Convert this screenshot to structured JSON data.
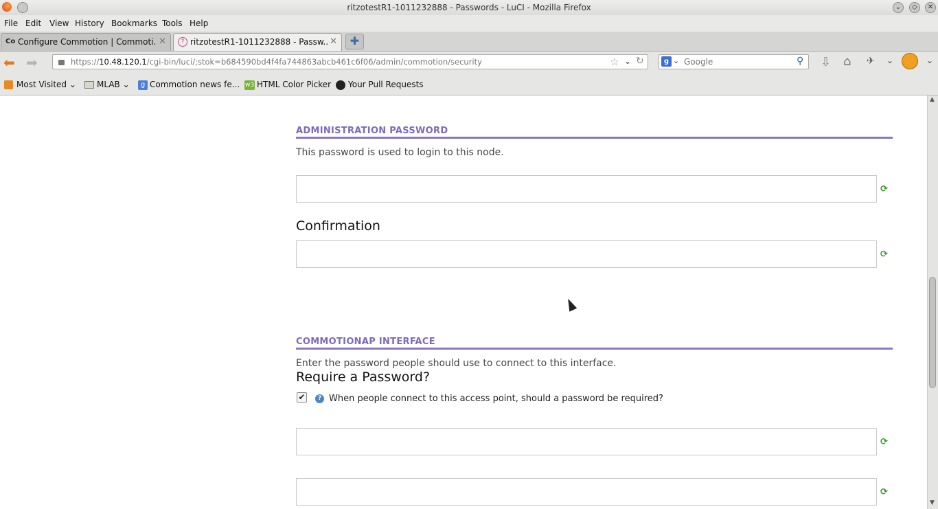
{
  "window": {
    "title": "ritzotestR1-1011232888 - Passwords - LuCI - Mozilla Firefox"
  },
  "menu": [
    "File",
    "Edit",
    "View",
    "History",
    "Bookmarks",
    "Tools",
    "Help"
  ],
  "tabs": [
    {
      "label": "Configure Commotion | Commoti...",
      "favicon": "Co"
    },
    {
      "label": "ritzotestR1-1011232888 - Passw...",
      "favicon": "?"
    }
  ],
  "url": {
    "scheme": "https://",
    "host": "10.48.120.1",
    "path": "/cgi-bin/luci/;stok=b684590bd4f4fa744863abcb461c6f06/admin/commotion/security"
  },
  "search": {
    "placeholder": "Google"
  },
  "bookmarks": [
    "Most Visited",
    "MLAB",
    "Commotion news fe...",
    "HTML Color Picker",
    "Your Pull Requests"
  ],
  "admin": {
    "heading": "ADMINISTRATION PASSWORD",
    "description": "This password is used to login to this node.",
    "confirmation_label": "Confirmation"
  },
  "ap": {
    "heading": "COMMOTIONAP INTERFACE",
    "description": "Enter the password people should use to connect to this interface.",
    "require_label": "Require a Password?",
    "require_checked": true,
    "require_hint": "When people connect to this access point, should a password be required?"
  },
  "icons": {
    "reload": "refresh-icon",
    "help": "help-icon"
  },
  "colors": {
    "section_accent": "#8878c6",
    "reload_green": "#3a9a2c"
  }
}
